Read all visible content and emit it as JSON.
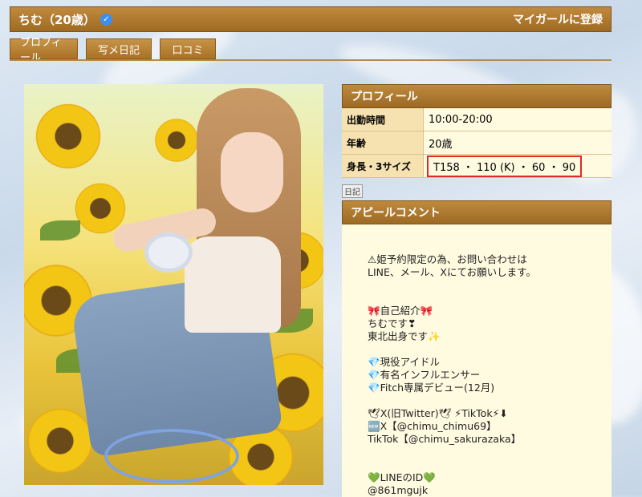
{
  "header": {
    "name": "ちむ（20歳）",
    "verified_icon": "verified-check-icon",
    "register_label": "マイガールに登録"
  },
  "tabs": [
    {
      "label": "プロフィール"
    },
    {
      "label": "写メ日記"
    },
    {
      "label": "口コミ"
    }
  ],
  "profile": {
    "heading": "プロフィール",
    "rows": [
      {
        "label": "出勤時間",
        "value": "10:00-20:00"
      },
      {
        "label": "年齢",
        "value": "20歳"
      },
      {
        "label": "身長・3サイズ",
        "value": "T158 ・ 110 (K) ・ 60 ・ 90"
      }
    ]
  },
  "diary_link": "日記",
  "appeal": {
    "heading": "アピールコメント",
    "lines": [
      "⚠姫予約限定の為、お問い合わせは",
      "LINE、メール、Xにてお願いします。",
      "",
      "",
      "🎀自己紹介🎀",
      "ちむです❣",
      "東北出身です✨",
      "",
      "💎現役アイドル",
      "💎有名インフルエンサー",
      "💎Fitch専属デビュー(12月)",
      "",
      "🕊X(旧Twitter)🕊 ⚡TikTok⚡⬇",
      "🆕X【@chimu_chimu69】",
      "TikTok【@chimu_sakurazaka】",
      "",
      "",
      "💚LINEのID💚",
      "@861mgujk"
    ]
  },
  "colors": {
    "header_bg": "#a97226",
    "cell_label_bg": "#f6e2b0",
    "cell_value_bg": "#fffbe0",
    "highlight_border": "#e02a2a"
  }
}
